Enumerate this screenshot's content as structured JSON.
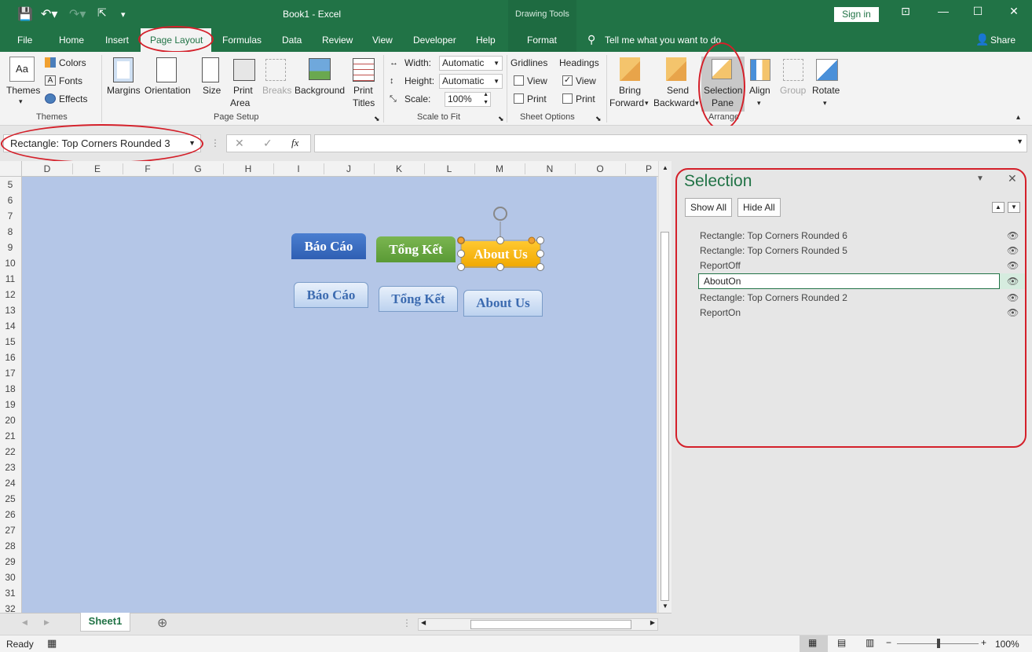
{
  "window": {
    "title": "Book1  -  Excel",
    "context_tab_header": "Drawing Tools",
    "signin": "Sign in",
    "share": "Share",
    "tell_me": "Tell me what you want to do"
  },
  "tabs": [
    "File",
    "Home",
    "Insert",
    "Page Layout",
    "Formulas",
    "Data",
    "Review",
    "View",
    "Developer",
    "Help",
    "Format"
  ],
  "ribbon": {
    "themes": {
      "themes": "Themes",
      "colors": "Colors",
      "fonts": "Fonts",
      "effects": "Effects",
      "group": "Themes"
    },
    "page_setup": {
      "margins": "Margins",
      "orientation": "Orientation",
      "size": "Size",
      "print_area_1": "Print",
      "print_area_2": "Area",
      "breaks": "Breaks",
      "background": "Background",
      "print_titles_1": "Print",
      "print_titles_2": "Titles",
      "group": "Page Setup"
    },
    "scale": {
      "width_label": "Width:",
      "width_value": "Automatic",
      "height_label": "Height:",
      "height_value": "Automatic",
      "scale_label": "Scale:",
      "scale_value": "100%",
      "group": "Scale to Fit"
    },
    "sheet_options": {
      "gridlines": "Gridlines",
      "headings": "Headings",
      "view": "View",
      "print": "Print",
      "group": "Sheet Options",
      "gridlines_view_checked": false,
      "gridlines_print_checked": false,
      "headings_view_checked": true,
      "headings_print_checked": false
    },
    "arrange": {
      "bring_1": "Bring",
      "bring_2": "Forward",
      "send_1": "Send",
      "send_2": "Backward",
      "sel_1": "Selection",
      "sel_2": "Pane",
      "align": "Align",
      "group_btn": "Group",
      "rotate": "Rotate",
      "group": "Arrange"
    }
  },
  "formula_bar": {
    "name_box": "Rectangle: Top Corners Rounded 3",
    "fx": "fx",
    "formula": ""
  },
  "columns": [
    "D",
    "E",
    "F",
    "G",
    "H",
    "I",
    "J",
    "K",
    "L",
    "M",
    "N",
    "O",
    "P"
  ],
  "rows": [
    "5",
    "6",
    "7",
    "8",
    "9",
    "10",
    "11",
    "12",
    "13",
    "14",
    "15",
    "16",
    "17",
    "18",
    "19",
    "20",
    "21",
    "22",
    "23",
    "24",
    "25",
    "26",
    "27",
    "28",
    "29",
    "30",
    "31",
    "32"
  ],
  "shapes": {
    "row1": [
      "Báo Cáo",
      "Tổng Kết",
      "About Us"
    ],
    "row2": [
      "Báo Cáo",
      "Tổng Kết",
      "About Us"
    ]
  },
  "sheet_tab": "Sheet1",
  "status": {
    "ready": "Ready",
    "zoom": "100%"
  },
  "selection_pane": {
    "title": "Selection",
    "show_all": "Show All",
    "hide_all": "Hide All",
    "items": [
      "Rectangle: Top Corners Rounded 6",
      "Rectangle: Top Corners Rounded 5",
      "ReportOff",
      "AboutOn",
      "Rectangle: Top Corners Rounded 2",
      "ReportOn"
    ],
    "editing_item": "AboutOn"
  },
  "colors": {
    "excel_green": "#217346",
    "annotation_red": "#d4202a",
    "sheet_bg": "#b4c6e7"
  }
}
